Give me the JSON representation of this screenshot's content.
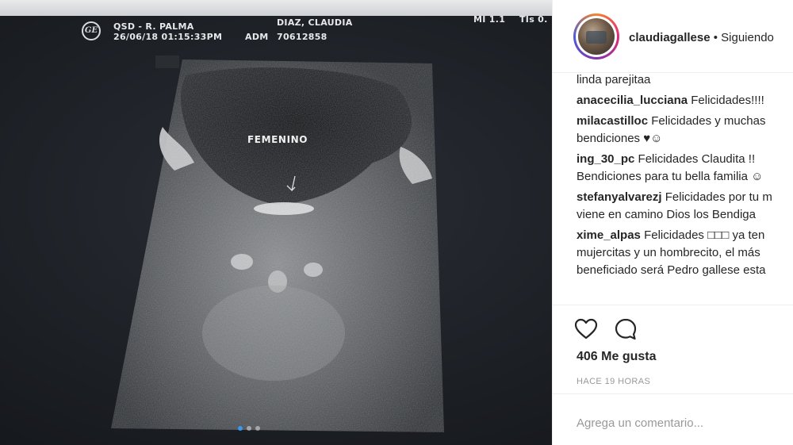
{
  "scan": {
    "clinic": "QSD - R. PALMA",
    "datetime": "26/06/18 01:15:33PM",
    "patient": "DIAZ, CLAUDIA",
    "adm_label": "ADM",
    "adm_number": "70612858",
    "mi": "MI 1.1",
    "tis": "TIs 0.",
    "logo": "GE",
    "label": "FEMENINO",
    "carousel_dots": 3,
    "active_dot": 0
  },
  "post": {
    "username": "claudiagallese",
    "follow_status": "• Siguiendo",
    "comments": [
      {
        "user": "",
        "text": "linda parejitaa"
      },
      {
        "user": "anacecilia_lucciana",
        "text": "Felicidades!!!!"
      },
      {
        "user": "milacastilloc",
        "text": "Felicidades y muchas",
        "cont": "bendiciones ♥☺"
      },
      {
        "user": "ing_30_pc",
        "text": "Felicidades Claudita !!",
        "cont": "Bendiciones para tu bella familia ☺"
      },
      {
        "user": "stefanyalvarezj",
        "text": "Felicidades por tu m",
        "cont": "viene en camino Dios los Bendiga"
      },
      {
        "user": "xime_alpas",
        "text": "Felicidades □□□ ya ten",
        "cont": "mujercitas y un hombrecito, el más",
        "cont2": "beneficiado será Pedro gallese esta"
      }
    ],
    "like_icon": "heart-icon",
    "comment_icon": "comment-icon",
    "likes_count": "406",
    "likes_label": "Me gusta",
    "timestamp": "HACE 19 HORAS",
    "comment_placeholder": "Agrega un comentario..."
  }
}
